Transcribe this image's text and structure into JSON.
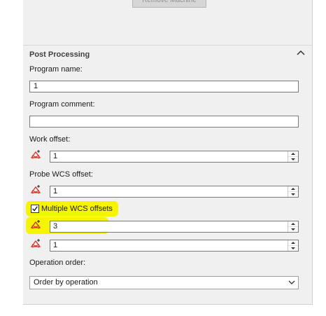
{
  "machine": {
    "remove_label": "Remove Machine"
  },
  "post_processing": {
    "section_title": "Post Processing",
    "program_name": {
      "label": "Program name:",
      "value": "1"
    },
    "program_comment": {
      "label": "Program comment:",
      "value": ""
    },
    "work_offset": {
      "label": "Work offset:",
      "value": "1"
    },
    "probe_wcs_offset": {
      "label": "Probe WCS offset:",
      "value": "1"
    },
    "multiple_wcs": {
      "label": "Multiple WCS offsets",
      "checked": true,
      "values": [
        "3",
        "1"
      ]
    },
    "operation_order": {
      "label": "Operation order:",
      "selected": "Order by operation"
    }
  },
  "colors": {
    "highlight": "#f7f400",
    "panel": "#f0f0f0",
    "icon_red": "#d9322a"
  },
  "icons": {
    "collapse": "chevron-up-icon",
    "wcs": "wcs-axes-icon",
    "dropdown": "chevron-down-icon"
  }
}
